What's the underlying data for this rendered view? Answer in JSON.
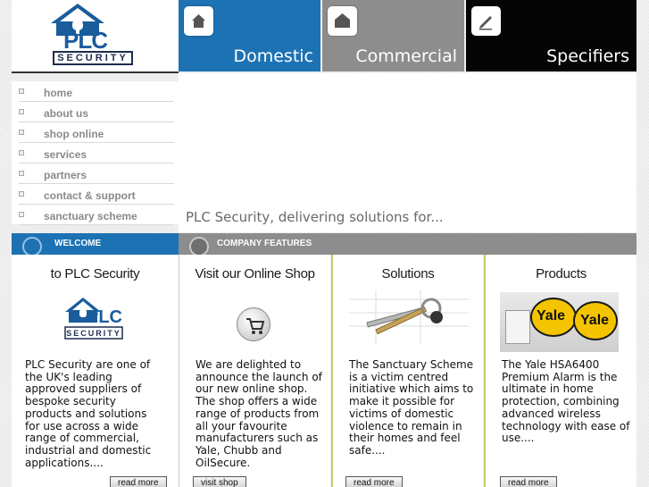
{
  "brand": {
    "logo_name": "PLC",
    "logo_subtitle": "SECURITY"
  },
  "tabs": [
    {
      "label": "Domestic",
      "icon": "house-icon",
      "color": "#1d72b4"
    },
    {
      "label": "Commercial",
      "icon": "building-icon",
      "color": "#8d8d8d"
    },
    {
      "label": "Specifiers",
      "icon": "pencil-icon",
      "color": "#050505"
    }
  ],
  "nav": {
    "items": [
      {
        "label": "home"
      },
      {
        "label": "about us"
      },
      {
        "label": "shop online"
      },
      {
        "label": "services"
      },
      {
        "label": "partners"
      },
      {
        "label": "contact & support"
      },
      {
        "label": "sanctuary scheme"
      }
    ]
  },
  "banner": {
    "tagline": "PLC Security, delivering solutions for..."
  },
  "sections": {
    "welcome": {
      "label": "WELCOME"
    },
    "features": {
      "label": "COMPANY FEATURES"
    }
  },
  "columns": {
    "welcome": {
      "title": "to PLC Security",
      "body": "PLC Security are one of the UK's leading approved suppliers of bespoke security products and solutions for use across a wide range of commercial, industrial and domestic applications....",
      "button": "read more"
    },
    "shop": {
      "title": "Visit our Online Shop",
      "body": "We are delighted to announce the launch of our new online shop. The shop offers a wide range of products from all your favourite manufacturers such as Yale, Chubb and OilSecure.",
      "button": "visit shop"
    },
    "solutions": {
      "title": "Solutions",
      "body": "The Sanctuary Scheme is a victim centred initiative which aims to make it possible for victims of domestic violence to remain in their homes and feel safe....",
      "button": "read more"
    },
    "products": {
      "title": "Products",
      "body": "The Yale HSA6400 Premium Alarm is the ultimate in home protection, combining advanced wireless technology with ease of use....",
      "button": "read more",
      "image_brand": "Yale"
    }
  }
}
